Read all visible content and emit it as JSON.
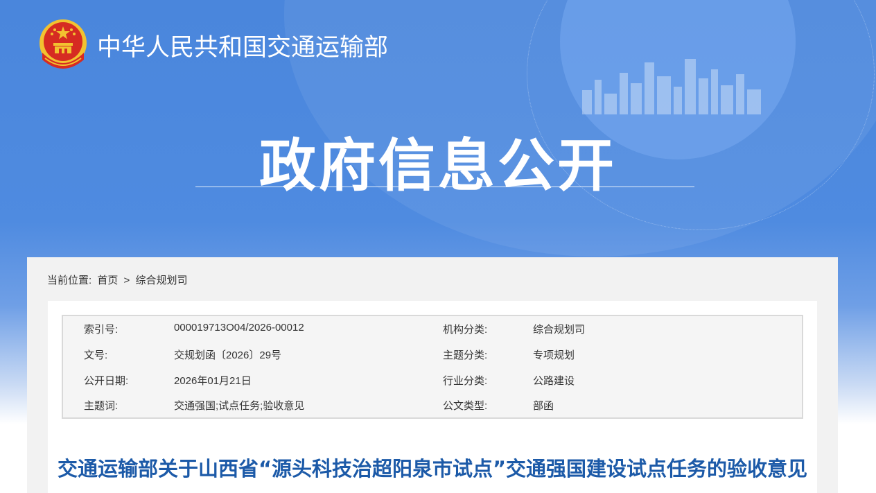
{
  "header": {
    "site_title": "中华人民共和国交通运输部",
    "section_title": "政府信息公开"
  },
  "breadcrumb": {
    "label": "当前位置:",
    "home": "首页",
    "separator": ">",
    "current": "综合规划司"
  },
  "meta": {
    "rows": [
      {
        "k1": "索引号:",
        "v1": "000019713O04/2026-00012",
        "k2": "机构分类:",
        "v2": "综合规划司"
      },
      {
        "k1": "文号:",
        "v1": "交规划函〔2026〕29号",
        "k2": "主题分类:",
        "v2": "专项规划"
      },
      {
        "k1": "公开日期:",
        "v1": "2026年01月21日",
        "k2": "行业分类:",
        "v2": "公路建设"
      },
      {
        "k1": "主题词:",
        "v1": "交通强国;试点任务;验收意见",
        "k2": "公文类型:",
        "v2": "部函"
      }
    ]
  },
  "document": {
    "title": "交通运输部关于山西省“源头科技治超阳泉市试点”交通强国建设试点任务的验收意见"
  },
  "colors": {
    "banner_blue": "#4a86dc",
    "title_blue": "#1c5aa8",
    "emblem_red": "#d62b22",
    "emblem_gold": "#f2c230"
  }
}
